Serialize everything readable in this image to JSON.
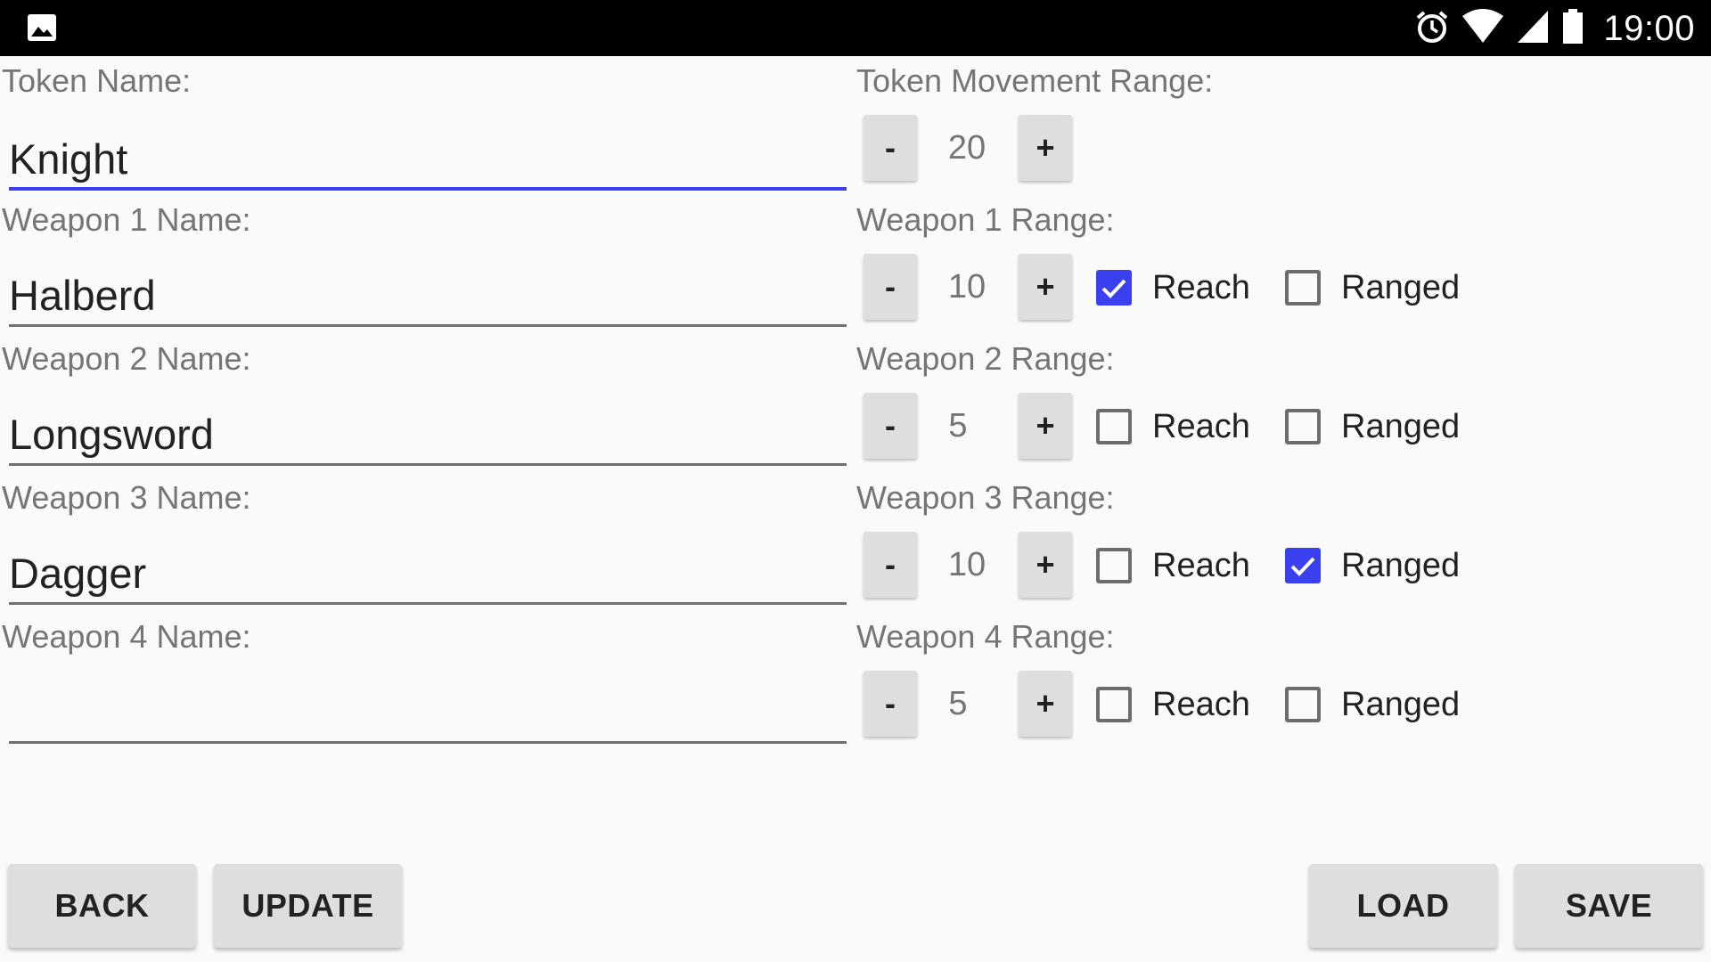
{
  "status_bar": {
    "left_icon": "image-icon",
    "icons": [
      "alarm-icon",
      "wifi-icon",
      "signal-icon",
      "battery-icon"
    ],
    "time": "19:00"
  },
  "token": {
    "name_label": "Token Name:",
    "name_value": "Knight",
    "movement_label": "Token Movement Range:",
    "movement_value": "20"
  },
  "weapons": [
    {
      "name_label": "Weapon 1 Name:",
      "name_value": "Halberd",
      "range_label": "Weapon 1 Range:",
      "range_value": "10",
      "reach": true,
      "ranged": false
    },
    {
      "name_label": "Weapon 2 Name:",
      "name_value": "Longsword",
      "range_label": "Weapon 2 Range:",
      "range_value": "5",
      "reach": false,
      "ranged": false
    },
    {
      "name_label": "Weapon 3 Name:",
      "name_value": "Dagger",
      "range_label": "Weapon 3 Range:",
      "range_value": "10",
      "reach": false,
      "ranged": true
    },
    {
      "name_label": "Weapon 4 Name:",
      "name_value": "",
      "range_label": "Weapon 4 Range:",
      "range_value": "5",
      "reach": false,
      "ranged": false
    }
  ],
  "stepper": {
    "minus_label": "-",
    "plus_label": "+"
  },
  "checkbox_labels": {
    "reach": "Reach",
    "ranged": "Ranged"
  },
  "buttons": {
    "back": "BACK",
    "update": "UPDATE",
    "load": "LOAD",
    "save": "SAVE"
  },
  "colors": {
    "accent": "#3a3ff0",
    "status_bar": "#000000",
    "background": "#fafafa",
    "button": "#dedede"
  }
}
